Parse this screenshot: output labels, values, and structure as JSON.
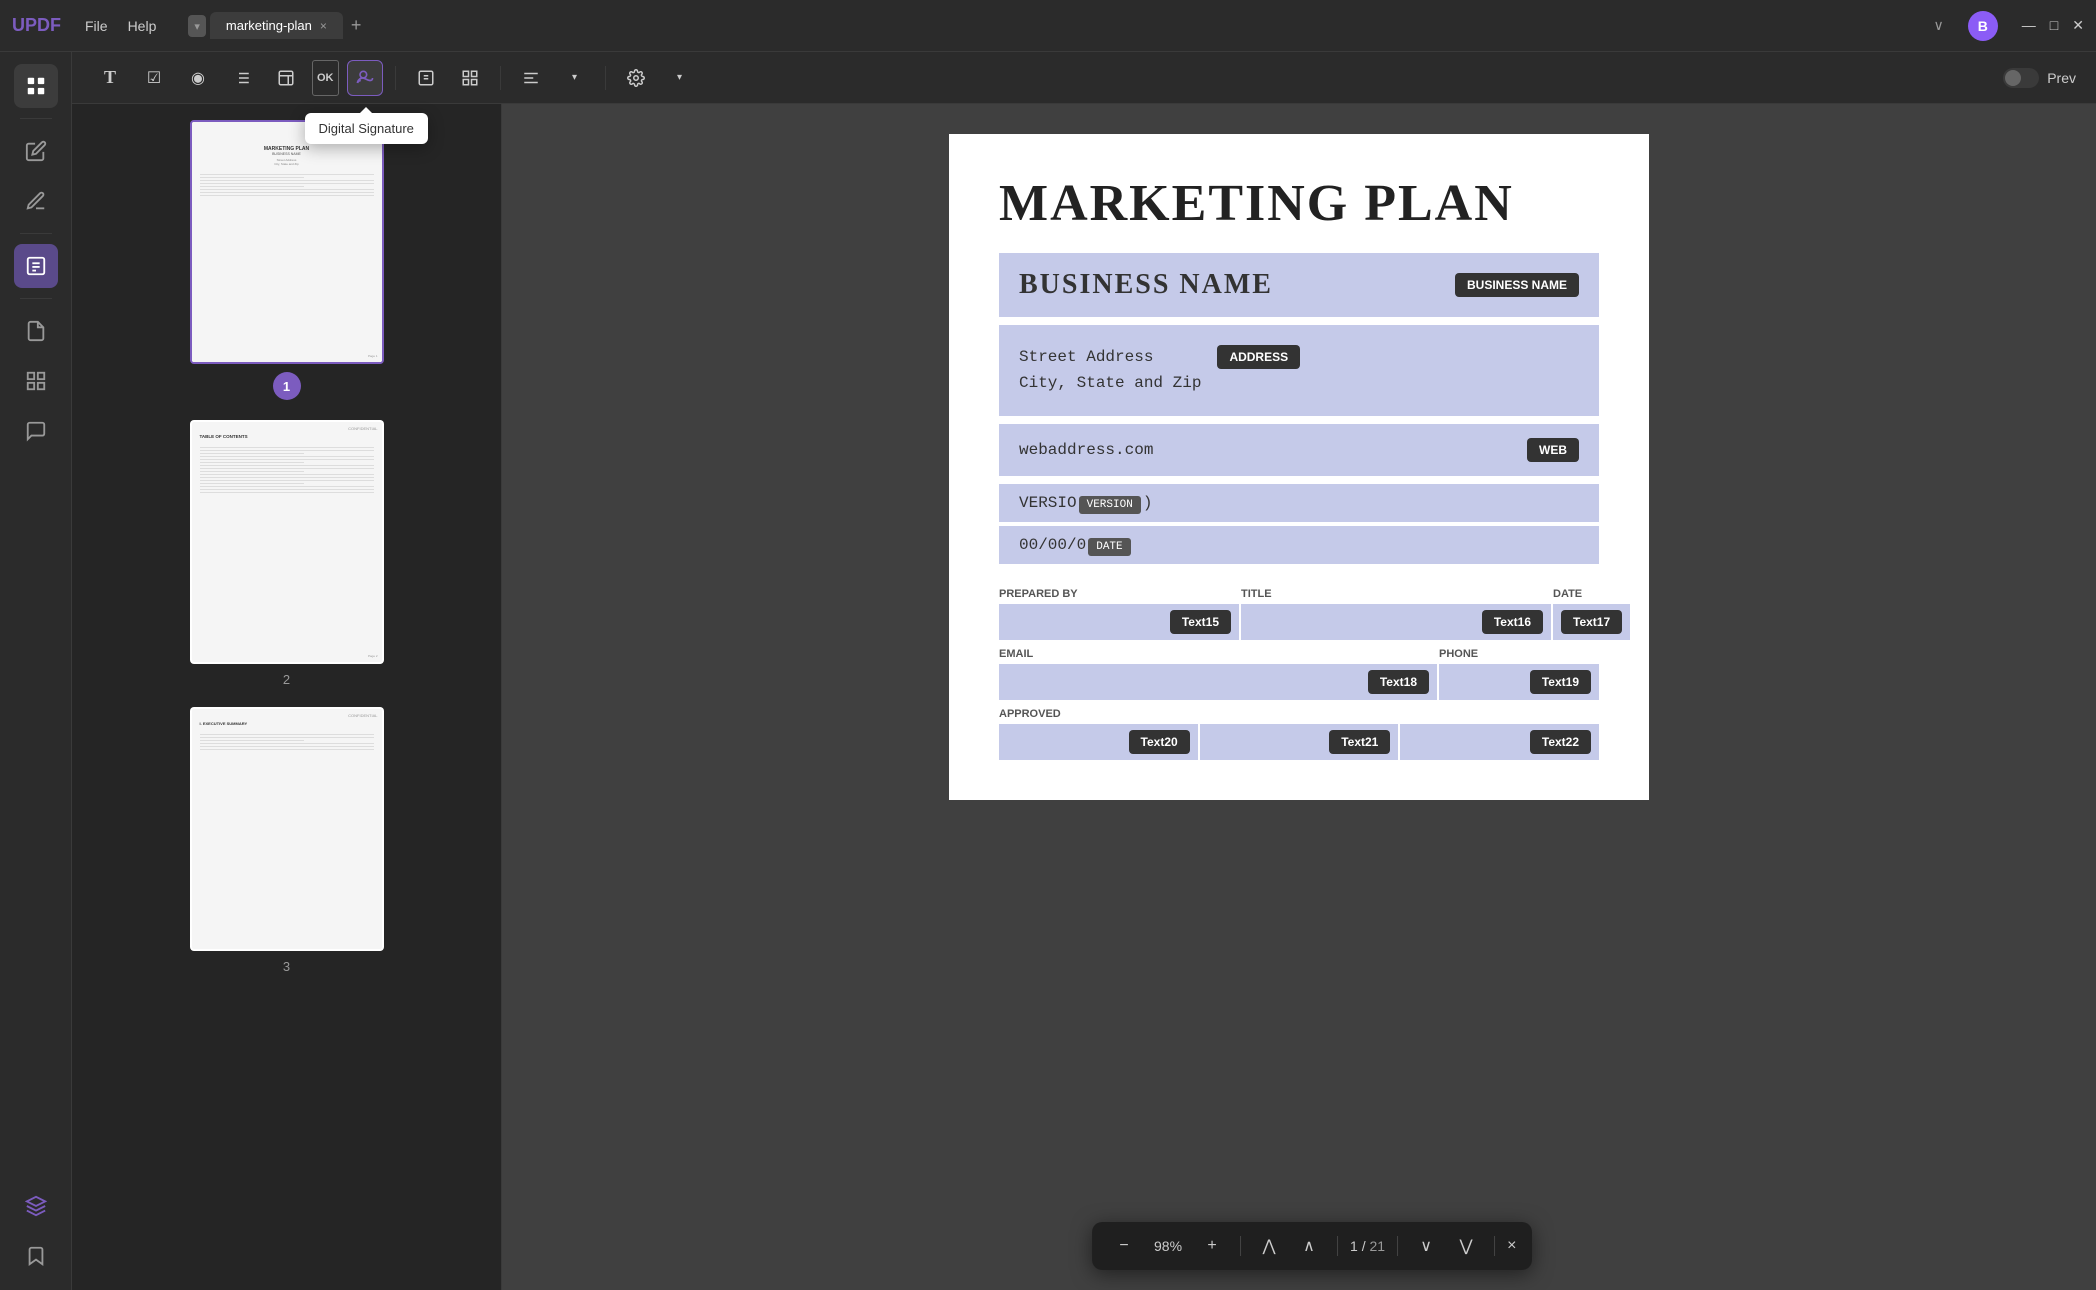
{
  "app": {
    "logo": "UPDF",
    "menu": [
      "File",
      "Help"
    ],
    "tab": {
      "name": "marketing-plan",
      "close_icon": "×"
    },
    "tab_add": "+",
    "chevron": "∨",
    "avatar_initial": "B",
    "window_controls": {
      "minimize": "—",
      "maximize": "□",
      "close": "✕"
    }
  },
  "toolbar": {
    "buttons": [
      {
        "name": "text-tool",
        "icon": "T",
        "label": "Text"
      },
      {
        "name": "checkbox-tool",
        "icon": "☑",
        "label": "Checkbox"
      },
      {
        "name": "radio-tool",
        "icon": "◉",
        "label": "Radio"
      },
      {
        "name": "list-tool",
        "icon": "≡",
        "label": "List"
      },
      {
        "name": "combo-tool",
        "icon": "▤",
        "label": "Combo"
      },
      {
        "name": "button-tool",
        "icon": "OK",
        "label": "Button"
      },
      {
        "name": "signature-tool",
        "icon": "✍",
        "label": "Signature"
      },
      {
        "name": "edit-tool",
        "icon": "✏",
        "label": "Edit"
      },
      {
        "name": "grid-tool",
        "icon": "⊞",
        "label": "Grid"
      },
      {
        "name": "align-tool",
        "icon": "≣",
        "label": "Align"
      },
      {
        "name": "settings-tool",
        "icon": "⚙",
        "label": "Settings"
      }
    ],
    "tooltip": "Digital Signature",
    "prev_label": "Prev",
    "prev_toggle": false
  },
  "thumbnails": [
    {
      "number": 1,
      "label": "1",
      "selected": true
    },
    {
      "number": 2,
      "label": "2",
      "selected": false
    },
    {
      "number": 3,
      "label": "3",
      "selected": false
    }
  ],
  "document": {
    "title": "MARKETING PLAN",
    "confidential": "CONFIDENTIAL",
    "business_name_text": "BUSINESS NAME",
    "business_name_badge": "BUSINESS NAME",
    "address_line1": "Street Address",
    "address_line2": "City, State and Zip",
    "address_badge": "ADDRESS",
    "web_text": "webaddress.com",
    "web_badge": "WEB",
    "version_prefix": "VERSIO",
    "version_badge": "VERSION",
    "version_suffix": "",
    "date_prefix": "00/00/0",
    "date_badge": "DATE",
    "prepared_by_label": "PREPARED BY",
    "title_label": "TITLE",
    "date_label": "DATE",
    "email_label": "EMAIL",
    "phone_label": "PHONE",
    "approved_label": "APPROVED",
    "fields": {
      "text15": "Text15",
      "text16": "Text16",
      "text17": "Text17",
      "text18": "Text18",
      "text19": "Text19",
      "text20": "Text20",
      "text21": "Text21",
      "text22": "Text22"
    }
  },
  "bottom_toolbar": {
    "zoom_out": "−",
    "zoom_percent": "98%",
    "zoom_in": "+",
    "page_current": "1",
    "page_separator": "/",
    "page_total": "21",
    "nav_first": "⋀",
    "nav_prev": "∧",
    "nav_next": "∨",
    "nav_last": "⋁",
    "close": "×"
  }
}
